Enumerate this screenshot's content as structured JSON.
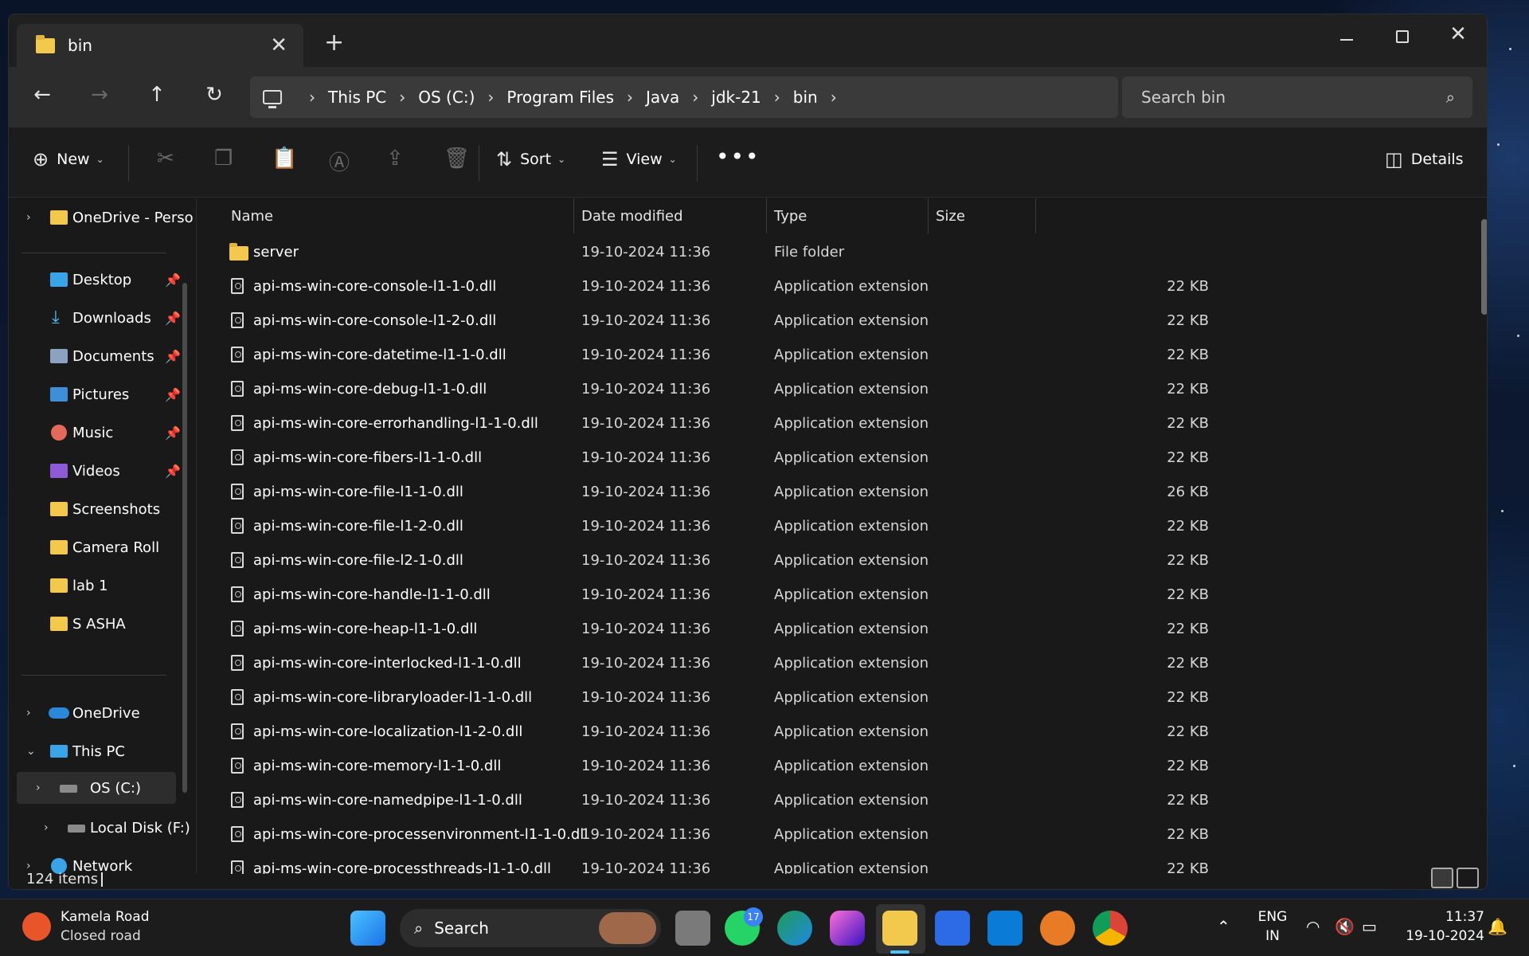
{
  "window": {
    "tab_title": "bin",
    "tab_close": "✕",
    "new_tab": "+",
    "minimize": "minimize",
    "maximize": "maximize",
    "close": "✕"
  },
  "nav": {
    "back": "←",
    "forward": "→",
    "up": "↑",
    "refresh": "↻"
  },
  "address": {
    "crumbs": [
      "This PC",
      "OS (C:)",
      "Program Files",
      "Java",
      "jdk-21",
      "bin"
    ],
    "separator": "›"
  },
  "search": {
    "placeholder": "Search bin"
  },
  "commands": {
    "new": "New",
    "sort": "Sort",
    "view": "View",
    "more": "•••",
    "details": "Details"
  },
  "sidebar": {
    "onedrive_personal": "OneDrive - Perso",
    "quick": [
      {
        "label": "Desktop",
        "icon": "desktop-icon"
      },
      {
        "label": "Downloads",
        "icon": "download-icon"
      },
      {
        "label": "Documents",
        "icon": "documents-icon"
      },
      {
        "label": "Pictures",
        "icon": "pictures-icon"
      },
      {
        "label": "Music",
        "icon": "music-icon"
      },
      {
        "label": "Videos",
        "icon": "videos-icon"
      }
    ],
    "folders": [
      "Screenshots",
      "Camera Roll",
      "lab 1",
      "S ASHA"
    ],
    "onedrive": "OneDrive",
    "this_pc": "This PC",
    "os_c": "OS (C:)",
    "local_disk": "Local Disk (F:)",
    "network": "Network"
  },
  "columns": {
    "name": "Name",
    "date": "Date modified",
    "type": "Type",
    "size": "Size"
  },
  "files": [
    {
      "name": "server",
      "date": "19-10-2024 11:36",
      "type": "File folder",
      "size": ""
    },
    {
      "name": "api-ms-win-core-console-l1-1-0.dll",
      "date": "19-10-2024 11:36",
      "type": "Application extension",
      "size": "22 KB"
    },
    {
      "name": "api-ms-win-core-console-l1-2-0.dll",
      "date": "19-10-2024 11:36",
      "type": "Application extension",
      "size": "22 KB"
    },
    {
      "name": "api-ms-win-core-datetime-l1-1-0.dll",
      "date": "19-10-2024 11:36",
      "type": "Application extension",
      "size": "22 KB"
    },
    {
      "name": "api-ms-win-core-debug-l1-1-0.dll",
      "date": "19-10-2024 11:36",
      "type": "Application extension",
      "size": "22 KB"
    },
    {
      "name": "api-ms-win-core-errorhandling-l1-1-0.dll",
      "date": "19-10-2024 11:36",
      "type": "Application extension",
      "size": "22 KB"
    },
    {
      "name": "api-ms-win-core-fibers-l1-1-0.dll",
      "date": "19-10-2024 11:36",
      "type": "Application extension",
      "size": "22 KB"
    },
    {
      "name": "api-ms-win-core-file-l1-1-0.dll",
      "date": "19-10-2024 11:36",
      "type": "Application extension",
      "size": "26 KB"
    },
    {
      "name": "api-ms-win-core-file-l1-2-0.dll",
      "date": "19-10-2024 11:36",
      "type": "Application extension",
      "size": "22 KB"
    },
    {
      "name": "api-ms-win-core-file-l2-1-0.dll",
      "date": "19-10-2024 11:36",
      "type": "Application extension",
      "size": "22 KB"
    },
    {
      "name": "api-ms-win-core-handle-l1-1-0.dll",
      "date": "19-10-2024 11:36",
      "type": "Application extension",
      "size": "22 KB"
    },
    {
      "name": "api-ms-win-core-heap-l1-1-0.dll",
      "date": "19-10-2024 11:36",
      "type": "Application extension",
      "size": "22 KB"
    },
    {
      "name": "api-ms-win-core-interlocked-l1-1-0.dll",
      "date": "19-10-2024 11:36",
      "type": "Application extension",
      "size": "22 KB"
    },
    {
      "name": "api-ms-win-core-libraryloader-l1-1-0.dll",
      "date": "19-10-2024 11:36",
      "type": "Application extension",
      "size": "22 KB"
    },
    {
      "name": "api-ms-win-core-localization-l1-2-0.dll",
      "date": "19-10-2024 11:36",
      "type": "Application extension",
      "size": "22 KB"
    },
    {
      "name": "api-ms-win-core-memory-l1-1-0.dll",
      "date": "19-10-2024 11:36",
      "type": "Application extension",
      "size": "22 KB"
    },
    {
      "name": "api-ms-win-core-namedpipe-l1-1-0.dll",
      "date": "19-10-2024 11:36",
      "type": "Application extension",
      "size": "22 KB"
    },
    {
      "name": "api-ms-win-core-processenvironment-l1-1-0.dll",
      "date": "19-10-2024 11:36",
      "type": "Application extension",
      "size": "22 KB"
    },
    {
      "name": "api-ms-win-core-processthreads-l1-1-0.dll",
      "date": "19-10-2024 11:36",
      "type": "Application extension",
      "size": "22 KB"
    }
  ],
  "status": {
    "count": "124 items"
  },
  "taskbar": {
    "weather_title": "Kamela Road",
    "weather_sub": "Closed road",
    "search_label": "Search",
    "whatsapp_badge": "17",
    "lang1": "ENG",
    "lang2": "IN",
    "time": "11:37",
    "date": "19-10-2024"
  }
}
